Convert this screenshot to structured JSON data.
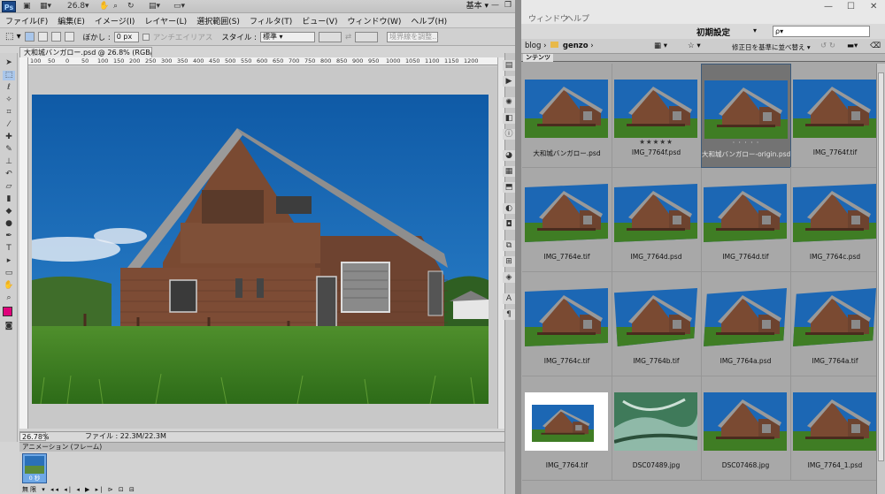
{
  "photoshop": {
    "logo": "Ps",
    "zoom_top": "26.8",
    "workspace": "基本",
    "menu": [
      "ファイル(F)",
      "編集(E)",
      "イメージ(I)",
      "レイヤー(L)",
      "選択範囲(S)",
      "フィルタ(T)",
      "ビュー(V)",
      "ウィンドウ(W)",
      "ヘルプ(H)"
    ],
    "options": {
      "feather_label": "ぼかし :",
      "feather_value": "0 px",
      "antialias": "アンチエイリアス",
      "style_label": "スタイル :",
      "style_value": "標準",
      "refine_edge": "境界線を調整..."
    },
    "document_tab": "大和城バンガロー.psd @ 26.8% (RGB/8)",
    "ruler_ticks": [
      "100",
      "50",
      "0",
      "50",
      "100",
      "150",
      "200",
      "250",
      "300",
      "350",
      "400",
      "450",
      "500",
      "550",
      "600",
      "650",
      "700",
      "750",
      "800",
      "850",
      "900",
      "950",
      "1000",
      "1050",
      "1100",
      "1150",
      "1200"
    ],
    "status": {
      "zoom": "26.78%",
      "file": "ファイル : 22.3M/22.3M"
    },
    "animation": {
      "title": "アニメーション (フレーム)",
      "frame_time": "0 秒",
      "loop": "無限",
      "controls": "◂◂ ◂| ◂ ▶ ▸| ⊳ ⊡ ⊟"
    },
    "colors": {
      "foreground": "#e0007a"
    }
  },
  "bridge": {
    "menu": [
      "ウィンドウ",
      "ヘルプ"
    ],
    "workspace": "初期設定",
    "search_placeholder": "ρ▾",
    "path": [
      "blog",
      "genzo"
    ],
    "sort": "修正日を基準に並べ替え ▾",
    "content_tab": "ンテンツ",
    "items": [
      {
        "name": "大和城バンガロー.psd",
        "stars": "",
        "frame": "plain",
        "selected": false
      },
      {
        "name": "IMG_7764f.psd",
        "stars": "★★★★★",
        "frame": "plain",
        "selected": false
      },
      {
        "name": "大和城バンガロー-origin.psd",
        "stars": "· · · · ·",
        "frame": "plain",
        "selected": true
      },
      {
        "name": "IMG_7764f.tif",
        "stars": "",
        "frame": "plain",
        "selected": false
      },
      {
        "name": "IMG_7764e.tif",
        "stars": "",
        "frame": "curl",
        "selected": false
      },
      {
        "name": "IMG_7764d.psd",
        "stars": "",
        "frame": "curl",
        "selected": false
      },
      {
        "name": "IMG_7764d.tif",
        "stars": "",
        "frame": "curl",
        "selected": false
      },
      {
        "name": "IMG_7764c.psd",
        "stars": "",
        "frame": "curl",
        "selected": false
      },
      {
        "name": "IMG_7764c.tif",
        "stars": "",
        "frame": "curl",
        "selected": false
      },
      {
        "name": "IMG_7764b.tif",
        "stars": "",
        "frame": "skew",
        "selected": false
      },
      {
        "name": "IMG_7764a.psd",
        "stars": "",
        "frame": "wide",
        "selected": false
      },
      {
        "name": "IMG_7764a.tif",
        "stars": "",
        "frame": "wide",
        "selected": false
      },
      {
        "name": "IMG_7764.tif",
        "stars": "",
        "frame": "white",
        "selected": false
      },
      {
        "name": "DSC07489.jpg",
        "stars": "",
        "frame": "water",
        "selected": false
      },
      {
        "name": "DSC07468.jpg",
        "stars": "",
        "frame": "plain",
        "selected": false
      },
      {
        "name": "IMG_7764_1.psd",
        "stars": "",
        "frame": "plain",
        "selected": false
      }
    ]
  }
}
